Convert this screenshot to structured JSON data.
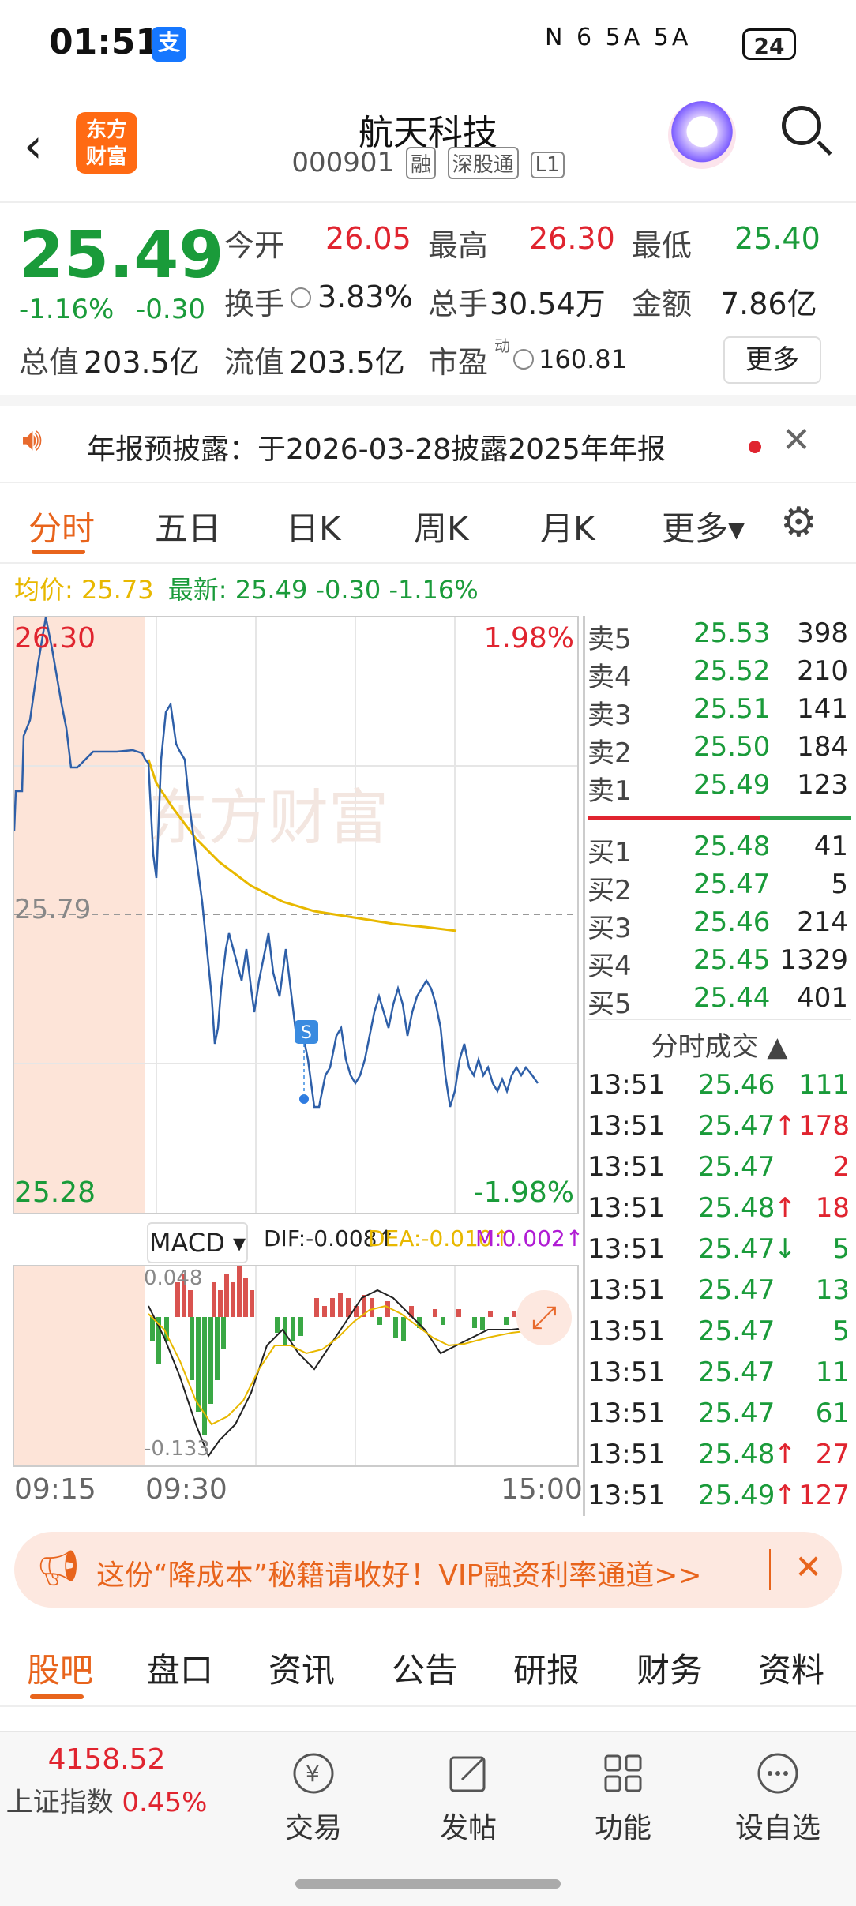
{
  "status": {
    "time": "01:51",
    "alipay_label": "支",
    "signal": "N  6  5A  5A",
    "battery": "24"
  },
  "header": {
    "app_logo": "东方\n财富",
    "title": "航天科技",
    "code": "000901",
    "tags": [
      "融",
      "深股通",
      "L1"
    ]
  },
  "quote": {
    "price": "25.49",
    "change_pct": "-1.16%",
    "change": "-0.30",
    "open_label": "今开",
    "open": "26.05",
    "high_label": "最高",
    "high": "26.30",
    "low_label": "最低",
    "low": "25.40",
    "turnover_label": "换手",
    "turnover": "3.83%",
    "volume_label": "总手",
    "volume": "30.54万",
    "amount_label": "金额",
    "amount": "7.86亿",
    "mktcap_label": "总值",
    "mktcap": "203.5亿",
    "float_label": "流值",
    "float": "203.5亿",
    "pe_label": "市盈",
    "pe_sup": "动",
    "pe": "160.81",
    "more": "更多"
  },
  "notice": {
    "text": "年报预披露：于2026-03-28披露2025年年报"
  },
  "tabs": [
    "分时",
    "五日",
    "日K",
    "周K",
    "月K",
    "更多▾"
  ],
  "avg": {
    "avg_label": "均价: 25.73",
    "latest_label": "最新: 25.49 -0.30 -1.16%"
  },
  "chart": {
    "top_price": "26.30",
    "mid_price": "25.79",
    "bottom_price": "25.28",
    "top_pct": "1.98%",
    "bottom_pct": "-1.98%",
    "time_start": "09:15",
    "time_open": "09:30",
    "time_end": "15:00",
    "watermark": "东方财富",
    "marker": "S"
  },
  "macd": {
    "selector": "MACD ▾",
    "dif": "DIF:-0.008↑",
    "dea": "DEA:-0.010↑",
    "m": "M:0.002↑",
    "top": "0.048",
    "bottom": "-0.133"
  },
  "orderbook": {
    "asks": [
      [
        "卖5",
        "25.53",
        "398"
      ],
      [
        "卖4",
        "25.52",
        "210"
      ],
      [
        "卖3",
        "25.51",
        "141"
      ],
      [
        "卖2",
        "25.50",
        "184"
      ],
      [
        "卖1",
        "25.49",
        "123"
      ]
    ],
    "bids": [
      [
        "买1",
        "25.48",
        "41"
      ],
      [
        "买2",
        "25.47",
        "5"
      ],
      [
        "买3",
        "25.46",
        "214"
      ],
      [
        "买4",
        "25.45",
        "1329"
      ],
      [
        "买5",
        "25.44",
        "401"
      ]
    ]
  },
  "trades_title": "分时成交 ▲",
  "trades": [
    [
      "13:51",
      "25.46",
      "",
      "111",
      "green"
    ],
    [
      "13:51",
      "25.47",
      "↑",
      "178",
      "red"
    ],
    [
      "13:51",
      "25.47",
      "",
      "2",
      "red"
    ],
    [
      "13:51",
      "25.48",
      "↑",
      "18",
      "red"
    ],
    [
      "13:51",
      "25.47",
      "↓",
      "5",
      "green"
    ],
    [
      "13:51",
      "25.47",
      "",
      "13",
      "green"
    ],
    [
      "13:51",
      "25.47",
      "",
      "5",
      "green"
    ],
    [
      "13:51",
      "25.47",
      "",
      "11",
      "green"
    ],
    [
      "13:51",
      "25.47",
      "",
      "61",
      "green"
    ],
    [
      "13:51",
      "25.48",
      "↑",
      "27",
      "red"
    ],
    [
      "13:51",
      "25.49",
      "↑",
      "127",
      "red"
    ]
  ],
  "banner": {
    "text": "这份“降成本”秘籍请收好！VIP融资利率通道>>"
  },
  "bottom_tabs": [
    "股吧",
    "盘口",
    "资讯",
    "公告",
    "研报",
    "财务",
    "资料"
  ],
  "bottom_nav": {
    "index_value": "4158.52",
    "index_name": "上证指数",
    "index_pct": "0.45%",
    "items": [
      "交易",
      "发帖",
      "功能",
      "设自选"
    ]
  },
  "colors": {
    "up": "#e0242f",
    "down": "#1a9b3a",
    "accent": "#ff6a13",
    "price_line": "#2e5fa8",
    "avg_line": "#e8b800"
  }
}
